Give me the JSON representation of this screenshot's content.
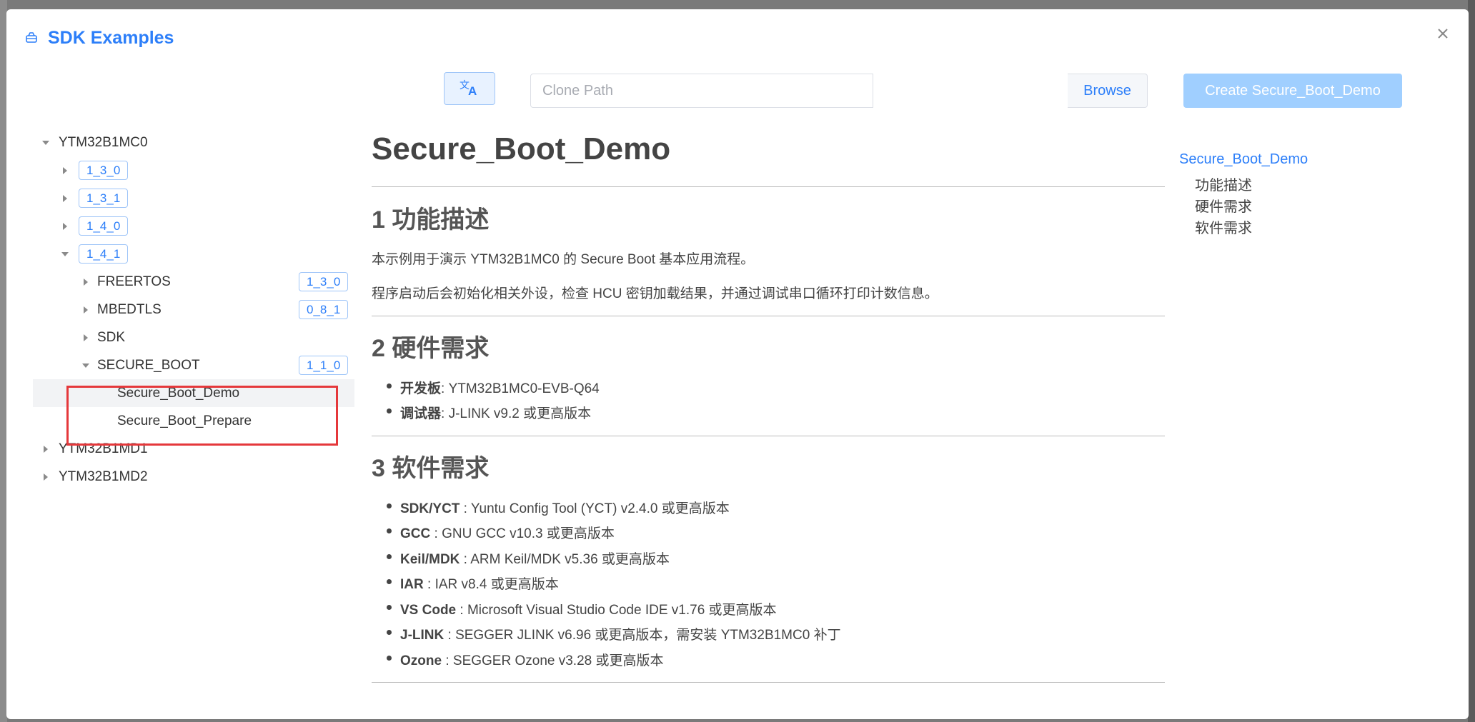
{
  "dialog": {
    "title": "SDK Examples"
  },
  "toolbar": {
    "clone_placeholder": "Clone Path",
    "clone_value": "",
    "browse_label": "Browse",
    "create_label": "Create Secure_Boot_Demo"
  },
  "tree": {
    "root1": "YTM32B1MC0",
    "versions": [
      "1_3_0",
      "1_3_1",
      "1_4_0",
      "1_4_1"
    ],
    "children": [
      {
        "label": "FREERTOS",
        "tag": "1_3_0"
      },
      {
        "label": "MBEDTLS",
        "tag": "0_8_1"
      },
      {
        "label": "SDK",
        "tag": ""
      },
      {
        "label": "SECURE_BOOT",
        "tag": "1_1_0"
      }
    ],
    "leaves": [
      "Secure_Boot_Demo",
      "Secure_Boot_Prepare"
    ],
    "root2": "YTM32B1MD1",
    "root3": "YTM32B1MD2"
  },
  "doc": {
    "title": "Secure_Boot_Demo",
    "s1_heading": "1 功能描述",
    "s1_p1": "本示例用于演示 YTM32B1MC0 的 Secure Boot 基本应用流程。",
    "s1_p2": "程序启动后会初始化相关外设，检查 HCU 密钥加载结果，并通过调试串口循环打印计数信息。",
    "s2_heading": "2 硬件需求",
    "s2_items": [
      {
        "key": "开发板",
        "val": ": YTM32B1MC0-EVB-Q64"
      },
      {
        "key": "调试器",
        "val": ": J-LINK v9.2 或更高版本"
      }
    ],
    "s3_heading": "3 软件需求",
    "s3_items": [
      {
        "key": "SDK/YCT",
        "val": " : Yuntu Config Tool (YCT) v2.4.0 或更高版本"
      },
      {
        "key": "GCC",
        "val": " : GNU GCC v10.3 或更高版本"
      },
      {
        "key": "Keil/MDK",
        "val": " : ARM Keil/MDK v5.36 或更高版本"
      },
      {
        "key": "IAR",
        "val": " : IAR v8.4 或更高版本"
      },
      {
        "key": "VS Code",
        "val": " : Microsoft Visual Studio Code IDE v1.76 或更高版本"
      },
      {
        "key": "J-LINK",
        "val": " : SEGGER JLINK v6.96 或更高版本，需安装 YTM32B1MC0 补丁"
      },
      {
        "key": "Ozone",
        "val": " : SEGGER Ozone v3.28 或更高版本"
      }
    ]
  },
  "toc": {
    "main": "Secure_Boot_Demo",
    "items": [
      "功能描述",
      "硬件需求",
      "软件需求"
    ]
  },
  "icons": {
    "title_icon": "box-icon",
    "translate_icon": "translate-icon",
    "close_icon": "close-icon"
  },
  "colors": {
    "accent": "#2d7ff9",
    "highlight": "#e5383b"
  }
}
